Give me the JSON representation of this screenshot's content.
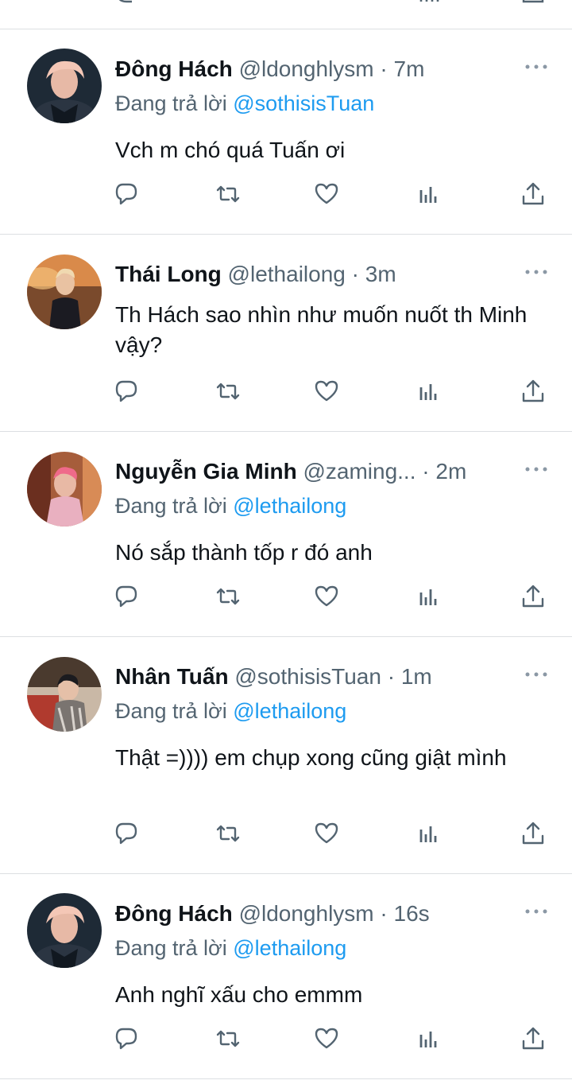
{
  "colors": {
    "text": "#0f1419",
    "secondary": "#536471",
    "mention": "#1d9bf0",
    "divider": "#dcdfe2"
  },
  "tweets": [
    {
      "name": "Đông Hách",
      "handle": "@ldonghlysm",
      "dot": "·",
      "time": "7m",
      "reply_prefix": "Đang trả lời ",
      "reply_to": "@sothisisTuan",
      "text": "Vch m chó quá Tuấn ơi"
    },
    {
      "name": "Thái Long",
      "handle": "@lethailong",
      "dot": "·",
      "time": "3m",
      "reply_prefix": "",
      "reply_to": "",
      "text": "Th Hách sao nhìn như muốn nuốt th Minh vậy?"
    },
    {
      "name": "Nguyễn Gia Minh",
      "handle": "@zaming...",
      "dot": "·",
      "time": "2m",
      "reply_prefix": "Đang trả lời ",
      "reply_to": "@lethailong",
      "text": "Nó sắp thành tốp r đó anh"
    },
    {
      "name": "Nhân Tuấn",
      "handle": "@sothisisTuan",
      "dot": "·",
      "time": "1m",
      "reply_prefix": "Đang trả lời ",
      "reply_to": "@lethailong",
      "text": "Thật =)))) em chụp xong cũng giật mình"
    },
    {
      "name": "Đông Hách",
      "handle": "@ldonghlysm",
      "dot": "·",
      "time": "16s",
      "reply_prefix": "Đang trả lời ",
      "reply_to": "@lethailong",
      "text": "Anh nghĩ xấu cho emmm"
    }
  ],
  "action_icons": [
    "reply-icon",
    "retweet-icon",
    "like-icon",
    "analytics-icon",
    "share-icon"
  ]
}
